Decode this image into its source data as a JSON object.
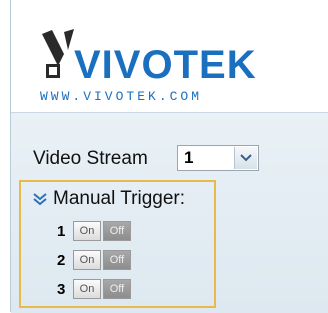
{
  "logo": {
    "brand": "VIVOTEK",
    "url_text": "WWW.VIVOTEK.COM",
    "brand_color": "#1a6fbf",
    "url_color": "#1a6fbf"
  },
  "video_stream": {
    "label": "Video Stream",
    "selected": "1",
    "arrow_icon": "chevron-down-icon"
  },
  "manual_trigger": {
    "title": "Manual Trigger:",
    "expand_icon": "double-chevron-down-icon",
    "rows": [
      {
        "number": "1",
        "on_label": "On",
        "off_label": "Off"
      },
      {
        "number": "2",
        "on_label": "On",
        "off_label": "Off"
      },
      {
        "number": "3",
        "on_label": "On",
        "off_label": "Off"
      }
    ]
  },
  "colors": {
    "panel_bg": "#e9f1f6",
    "highlight_border": "#e8b94b",
    "off_button": "#999999"
  }
}
